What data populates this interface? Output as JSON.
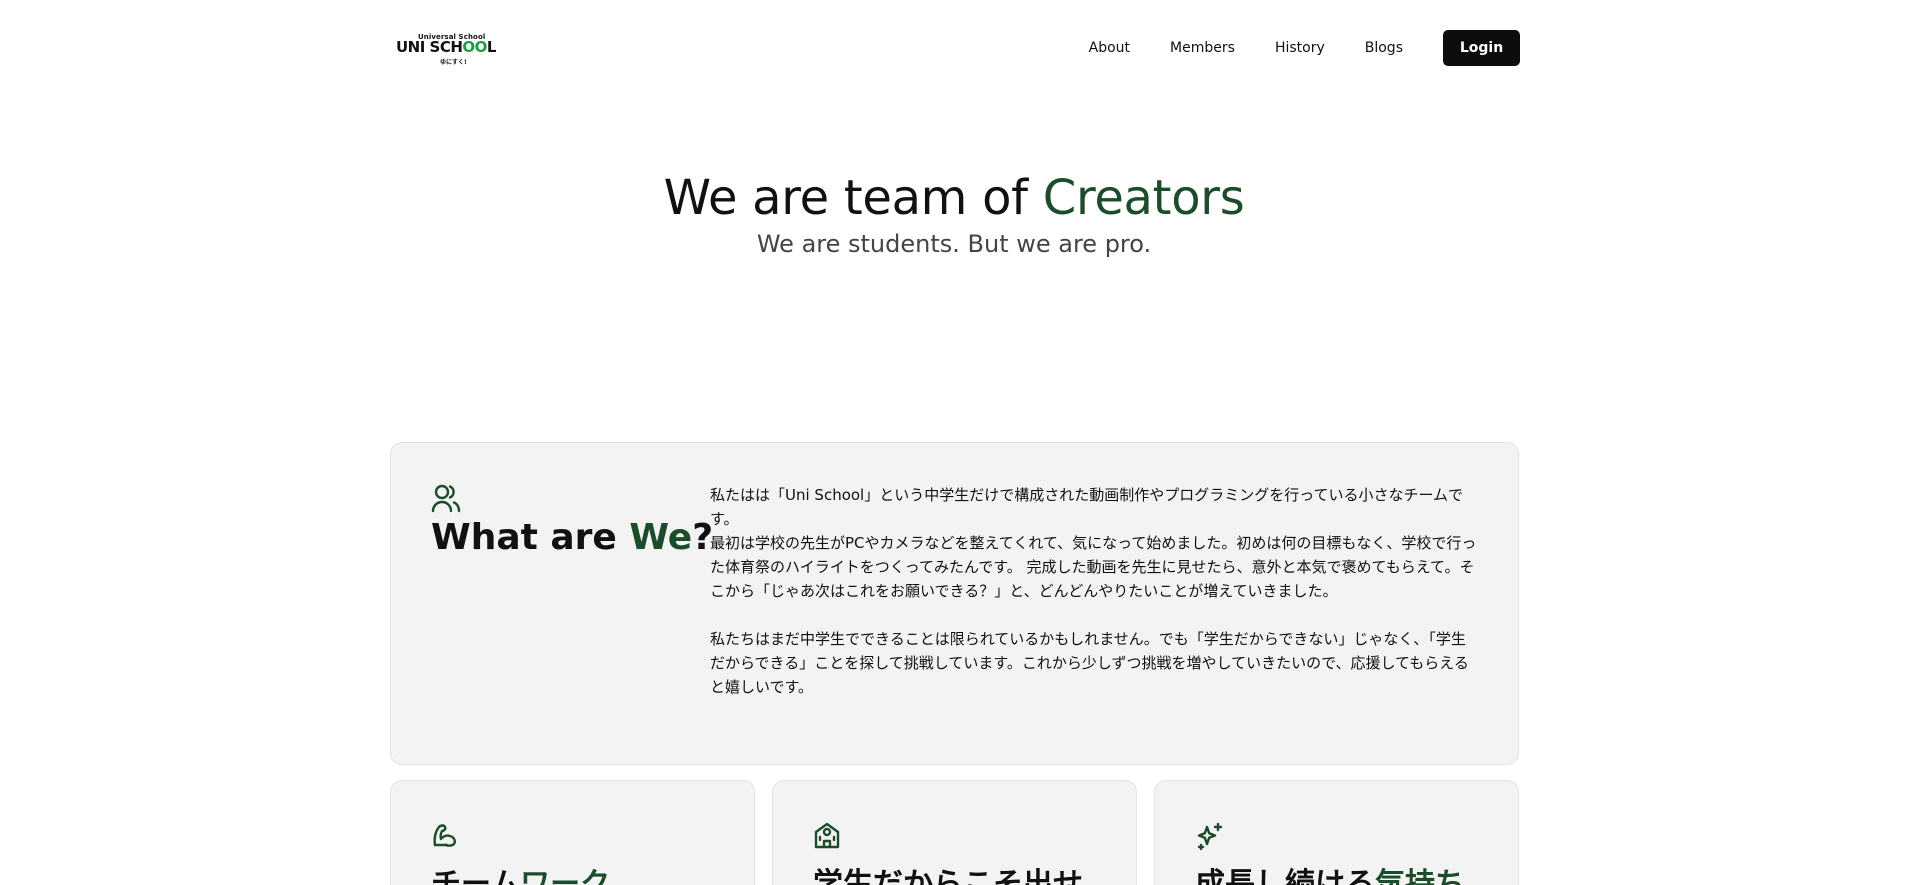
{
  "logo": {
    "top": "Universal School",
    "main_a": "UNI SCH",
    "main_b": "OO",
    "main_c": "L",
    "sub": "ゆにすく!"
  },
  "nav": {
    "about": "About",
    "members": "Members",
    "history": "History",
    "blogs": "Blogs",
    "login": "Login"
  },
  "hero": {
    "title_a": "We are team of ",
    "title_b": "Creators",
    "subtitle": "We are students. But we are pro."
  },
  "about": {
    "title_a": "What are ",
    "title_b": "We",
    "title_c": "?",
    "paragraph1": "私たはは「Uni School」という中学生だけで構成された動画制作やプログラミングを行っている小さなチームです。",
    "paragraph2": "最初は学校の先生がPCやカメラなどを整えてくれて、気になって始めました。初めは何の目標もなく、学校で行った体育祭のハイライトをつくってみたんです。 完成した動画を先生に見せたら、意外と本気で褒めてもらえて。そこから「じゃあ次はこれをお願いできる？」と、どんどんやりたいことが増えていきました。",
    "paragraph3": "私たちはまだ中学生でできることは限られているかもしれません。でも「学生だからできない」じゃなく、「学生だからできる」ことを探して挑戦しています。これから少しずつ挑戦を増やしていきたいので、応援してもらえると嬉しいです。"
  },
  "features": [
    {
      "title_a": "チーム",
      "title_b": "ワーク",
      "icon": "muscle-icon"
    },
    {
      "title_a": "学生だからこそ出せ",
      "title_b": "",
      "icon": "school-icon"
    },
    {
      "title_a": "成長し続ける",
      "title_b": "気持ち",
      "icon": "sparkles-icon"
    }
  ],
  "colors": {
    "accent": "#1b4d2b",
    "card_bg": "#f3f3f3",
    "button_bg": "#0d0d0d"
  }
}
